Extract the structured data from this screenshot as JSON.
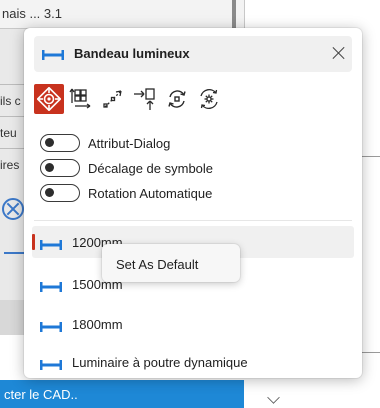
{
  "background": {
    "topbar_text": "nais  ... 3.1",
    "fragments": [
      "ils c",
      "teu",
      "ires"
    ],
    "bottom_bar_text": "cter le CAD.."
  },
  "popup": {
    "title": "Bandeau lumineux",
    "title_icon": "light-strip-icon",
    "close_icon": "close-icon",
    "toolbar": [
      {
        "name": "target-placement-icon",
        "active": true
      },
      {
        "name": "array-layout-icon",
        "active": false
      },
      {
        "name": "diagonal-distribute-icon",
        "active": false
      },
      {
        "name": "move-to-icon",
        "active": false
      },
      {
        "name": "rotate-icon",
        "active": false
      },
      {
        "name": "settings-cycle-icon",
        "active": false
      }
    ],
    "toggles": [
      {
        "label": "Attribut-Dialog",
        "on": false
      },
      {
        "label": "Décalage de symbole",
        "on": false
      },
      {
        "label": "Rotation Automatique",
        "on": false
      }
    ],
    "items": [
      {
        "label": "1200mm",
        "selected": true
      },
      {
        "label": "1500mm",
        "selected": false
      },
      {
        "label": "1800mm",
        "selected": false
      },
      {
        "label": "Luminaire à poutre dynamique",
        "selected": false
      }
    ],
    "context_menu": {
      "label": "Set As Default"
    }
  },
  "colors": {
    "accent": "#c8321e",
    "icon_blue": "#1e78d7",
    "bar_blue": "#1e88d6"
  }
}
